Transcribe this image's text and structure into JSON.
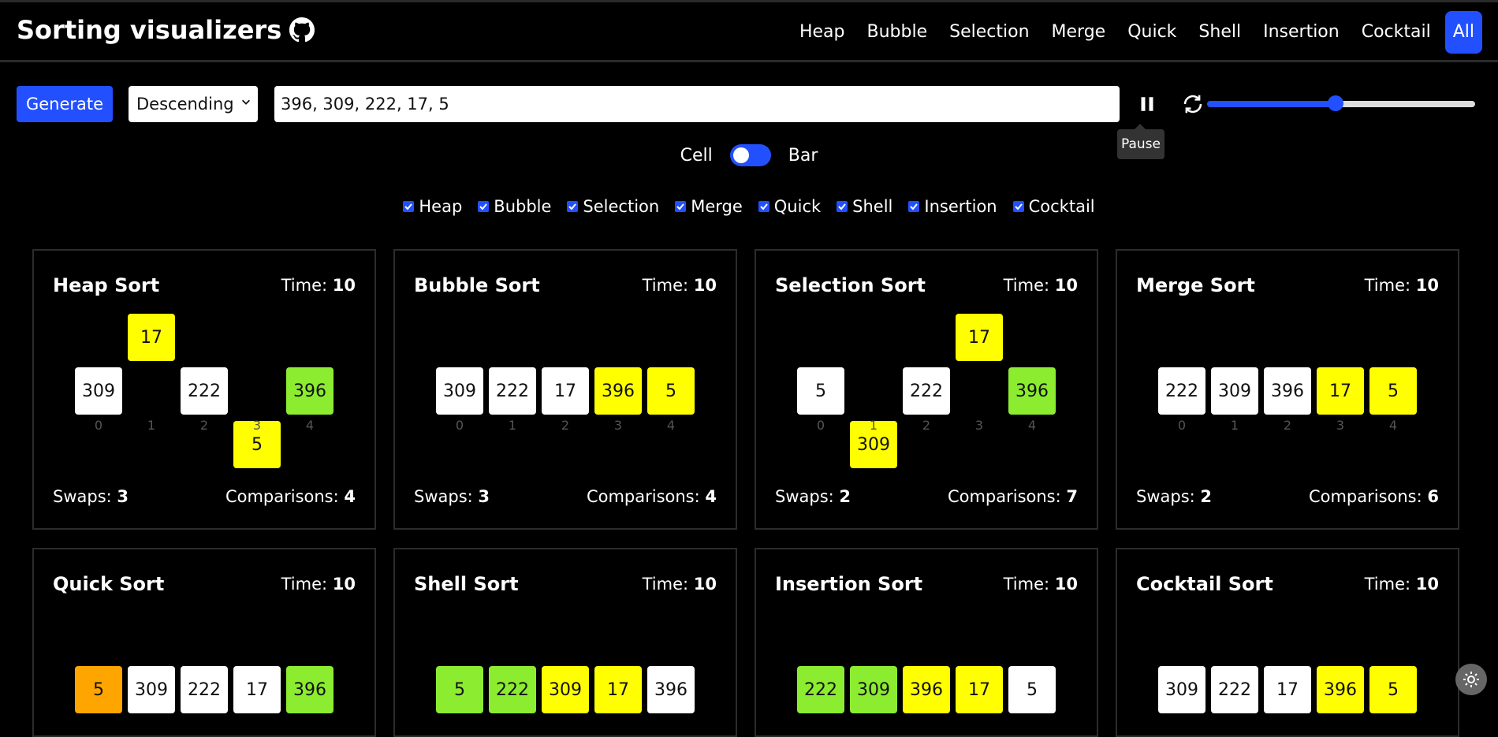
{
  "brand": {
    "title": "Sorting visualizers",
    "icon": "github-icon"
  },
  "nav": [
    {
      "label": "Heap"
    },
    {
      "label": "Bubble"
    },
    {
      "label": "Selection"
    },
    {
      "label": "Merge"
    },
    {
      "label": "Quick"
    },
    {
      "label": "Shell"
    },
    {
      "label": "Insertion"
    },
    {
      "label": "Cocktail"
    },
    {
      "label": "All",
      "active": true
    }
  ],
  "controls": {
    "generate_label": "Generate",
    "order_selected": "Descending",
    "array_value": "396, 309, 222, 17, 5",
    "pause_tooltip": "Pause",
    "speed_fraction": 0.48
  },
  "toggle": {
    "left_label": "Cell",
    "right_label": "Bar"
  },
  "checks": [
    "Heap",
    "Bubble",
    "Selection",
    "Merge",
    "Quick",
    "Shell",
    "Insertion",
    "Cocktail"
  ],
  "colors": {
    "accent": "#2250ff",
    "white": "#ffffff",
    "yellow": "#ffff00",
    "green": "#8cec30",
    "orange": "#ffa500"
  },
  "cards": [
    {
      "title": "Heap Sort",
      "time_label": "Time:",
      "time": "10",
      "swaps_label": "Swaps:",
      "swaps": "3",
      "comp_label": "Comparisons:",
      "comps": "4",
      "cells": [
        {
          "v": "309",
          "c": "white",
          "pos": 0
        },
        {
          "v": "17",
          "c": "yellow",
          "pos": -1
        },
        {
          "v": "222",
          "c": "white",
          "pos": 0
        },
        {
          "v": "5",
          "c": "yellow",
          "pos": 1
        },
        {
          "v": "396",
          "c": "green",
          "pos": 0
        }
      ],
      "indices": [
        "0",
        "1",
        "2",
        "3",
        "4"
      ]
    },
    {
      "title": "Bubble Sort",
      "time_label": "Time:",
      "time": "10",
      "swaps_label": "Swaps:",
      "swaps": "3",
      "comp_label": "Comparisons:",
      "comps": "4",
      "cells": [
        {
          "v": "309",
          "c": "white",
          "pos": 0
        },
        {
          "v": "222",
          "c": "white",
          "pos": 0
        },
        {
          "v": "17",
          "c": "white",
          "pos": 0
        },
        {
          "v": "396",
          "c": "yellow",
          "pos": 0
        },
        {
          "v": "5",
          "c": "yellow",
          "pos": 0
        }
      ],
      "indices": [
        "0",
        "1",
        "2",
        "3",
        "4"
      ]
    },
    {
      "title": "Selection Sort",
      "time_label": "Time:",
      "time": "10",
      "swaps_label": "Swaps:",
      "swaps": "2",
      "comp_label": "Comparisons:",
      "comps": "7",
      "cells": [
        {
          "v": "5",
          "c": "white",
          "pos": 0
        },
        {
          "v": "309",
          "c": "yellow",
          "pos": 1
        },
        {
          "v": "222",
          "c": "white",
          "pos": 0
        },
        {
          "v": "17",
          "c": "yellow",
          "pos": -1
        },
        {
          "v": "396",
          "c": "green",
          "pos": 0
        }
      ],
      "indices": [
        "0",
        "1",
        "2",
        "3",
        "4"
      ]
    },
    {
      "title": "Merge Sort",
      "time_label": "Time:",
      "time": "10",
      "swaps_label": "Swaps:",
      "swaps": "2",
      "comp_label": "Comparisons:",
      "comps": "6",
      "cells": [
        {
          "v": "222",
          "c": "white",
          "pos": 0
        },
        {
          "v": "309",
          "c": "white",
          "pos": 0
        },
        {
          "v": "396",
          "c": "white",
          "pos": 0
        },
        {
          "v": "17",
          "c": "yellow",
          "pos": 0
        },
        {
          "v": "5",
          "c": "yellow",
          "pos": 0
        }
      ],
      "indices": [
        "0",
        "1",
        "2",
        "3",
        "4"
      ]
    },
    {
      "title": "Quick Sort",
      "time_label": "Time:",
      "time": "10",
      "cells": [
        {
          "v": "5",
          "c": "orange",
          "pos": 0
        },
        {
          "v": "309",
          "c": "white",
          "pos": 0
        },
        {
          "v": "222",
          "c": "white",
          "pos": 0
        },
        {
          "v": "17",
          "c": "white",
          "pos": 0
        },
        {
          "v": "396",
          "c": "green",
          "pos": 0
        }
      ]
    },
    {
      "title": "Shell Sort",
      "time_label": "Time:",
      "time": "10",
      "cells": [
        {
          "v": "5",
          "c": "green",
          "pos": 0
        },
        {
          "v": "222",
          "c": "green",
          "pos": 0
        },
        {
          "v": "309",
          "c": "yellow",
          "pos": 0
        },
        {
          "v": "17",
          "c": "yellow",
          "pos": 0
        },
        {
          "v": "396",
          "c": "white",
          "pos": 0
        }
      ]
    },
    {
      "title": "Insertion Sort",
      "time_label": "Time:",
      "time": "10",
      "cells": [
        {
          "v": "222",
          "c": "green",
          "pos": 0
        },
        {
          "v": "309",
          "c": "green",
          "pos": 0
        },
        {
          "v": "396",
          "c": "yellow",
          "pos": 0
        },
        {
          "v": "17",
          "c": "yellow",
          "pos": 0
        },
        {
          "v": "5",
          "c": "white",
          "pos": 0
        }
      ]
    },
    {
      "title": "Cocktail Sort",
      "time_label": "Time:",
      "time": "10",
      "cells": [
        {
          "v": "309",
          "c": "white",
          "pos": 0
        },
        {
          "v": "222",
          "c": "white",
          "pos": 0
        },
        {
          "v": "17",
          "c": "white",
          "pos": 0
        },
        {
          "v": "396",
          "c": "yellow",
          "pos": 0
        },
        {
          "v": "5",
          "c": "yellow",
          "pos": 0
        }
      ]
    }
  ]
}
